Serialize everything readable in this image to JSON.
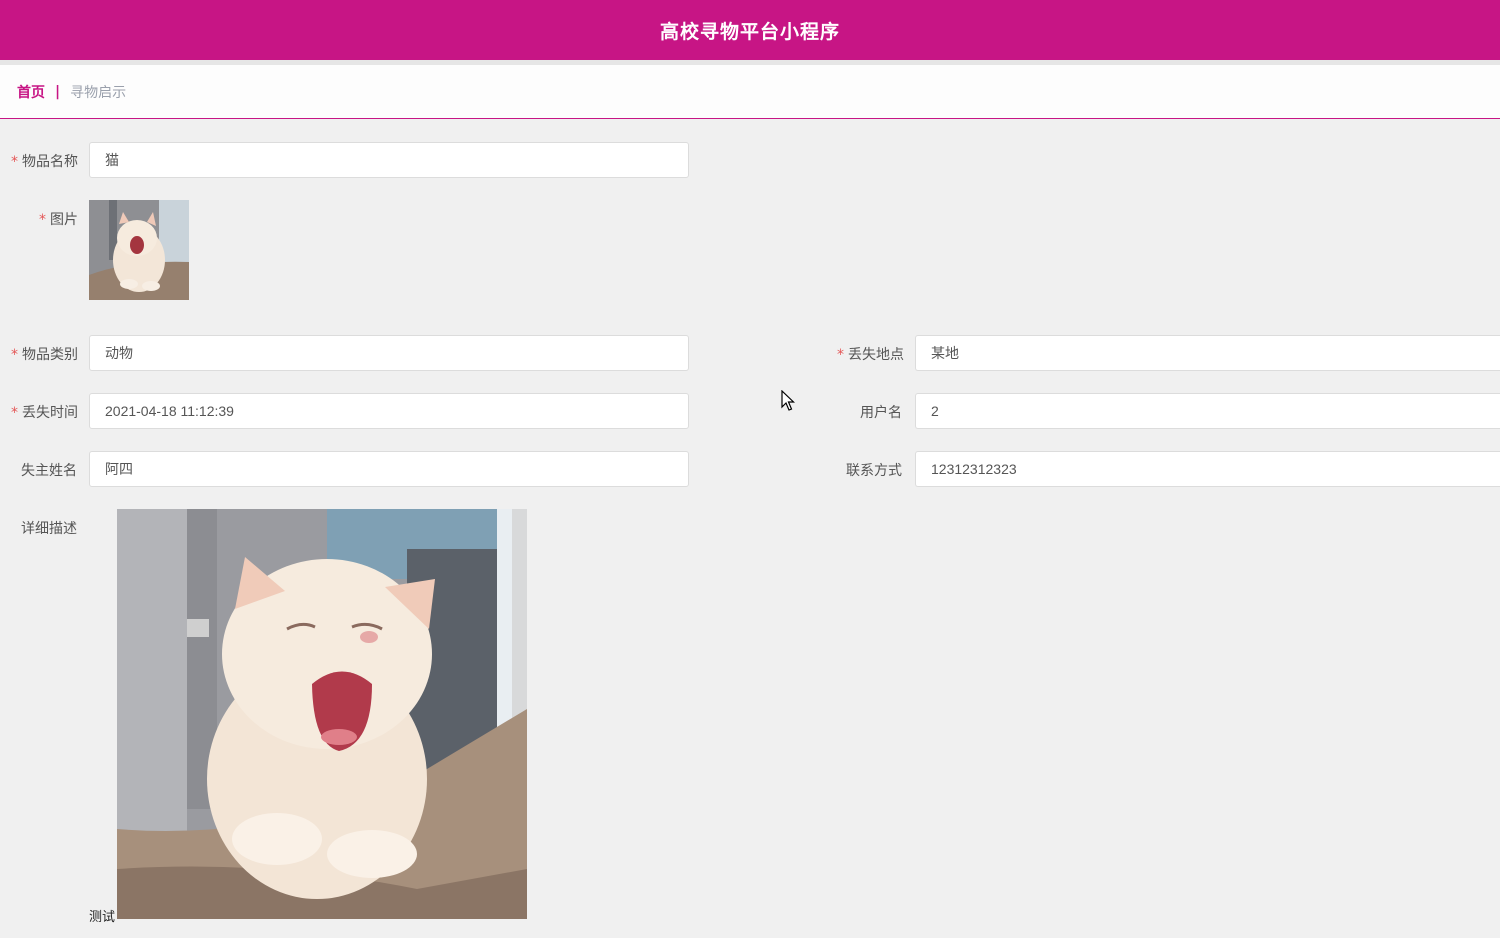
{
  "header": {
    "title": "高校寻物平台小程序"
  },
  "breadcrumb": {
    "home": "首页",
    "separator": "|",
    "current": "寻物启示"
  },
  "form": {
    "item_name": {
      "label": "物品名称",
      "required": true,
      "value": "猫"
    },
    "image": {
      "label": "图片",
      "required": true,
      "icon": "cat-photo"
    },
    "category": {
      "label": "物品类别",
      "required": true,
      "value": "动物"
    },
    "lost_place": {
      "label": "丢失地点",
      "required": true,
      "value": "某地"
    },
    "lost_time": {
      "label": "丢失时间",
      "required": true,
      "value": "2021-04-18 11:12:39"
    },
    "username": {
      "label": "用户名",
      "required": false,
      "value": "2"
    },
    "owner_name": {
      "label": "失主姓名",
      "required": false,
      "value": "阿四"
    },
    "contact": {
      "label": "联系方式",
      "required": false,
      "value": "12312312323"
    },
    "description": {
      "label": "详细描述",
      "text": "测试",
      "image_icon": "cat-photo"
    }
  },
  "colors": {
    "brand": "#c71585",
    "required_star": "#e45656",
    "breadcrumb_muted": "#9aa0ac"
  }
}
